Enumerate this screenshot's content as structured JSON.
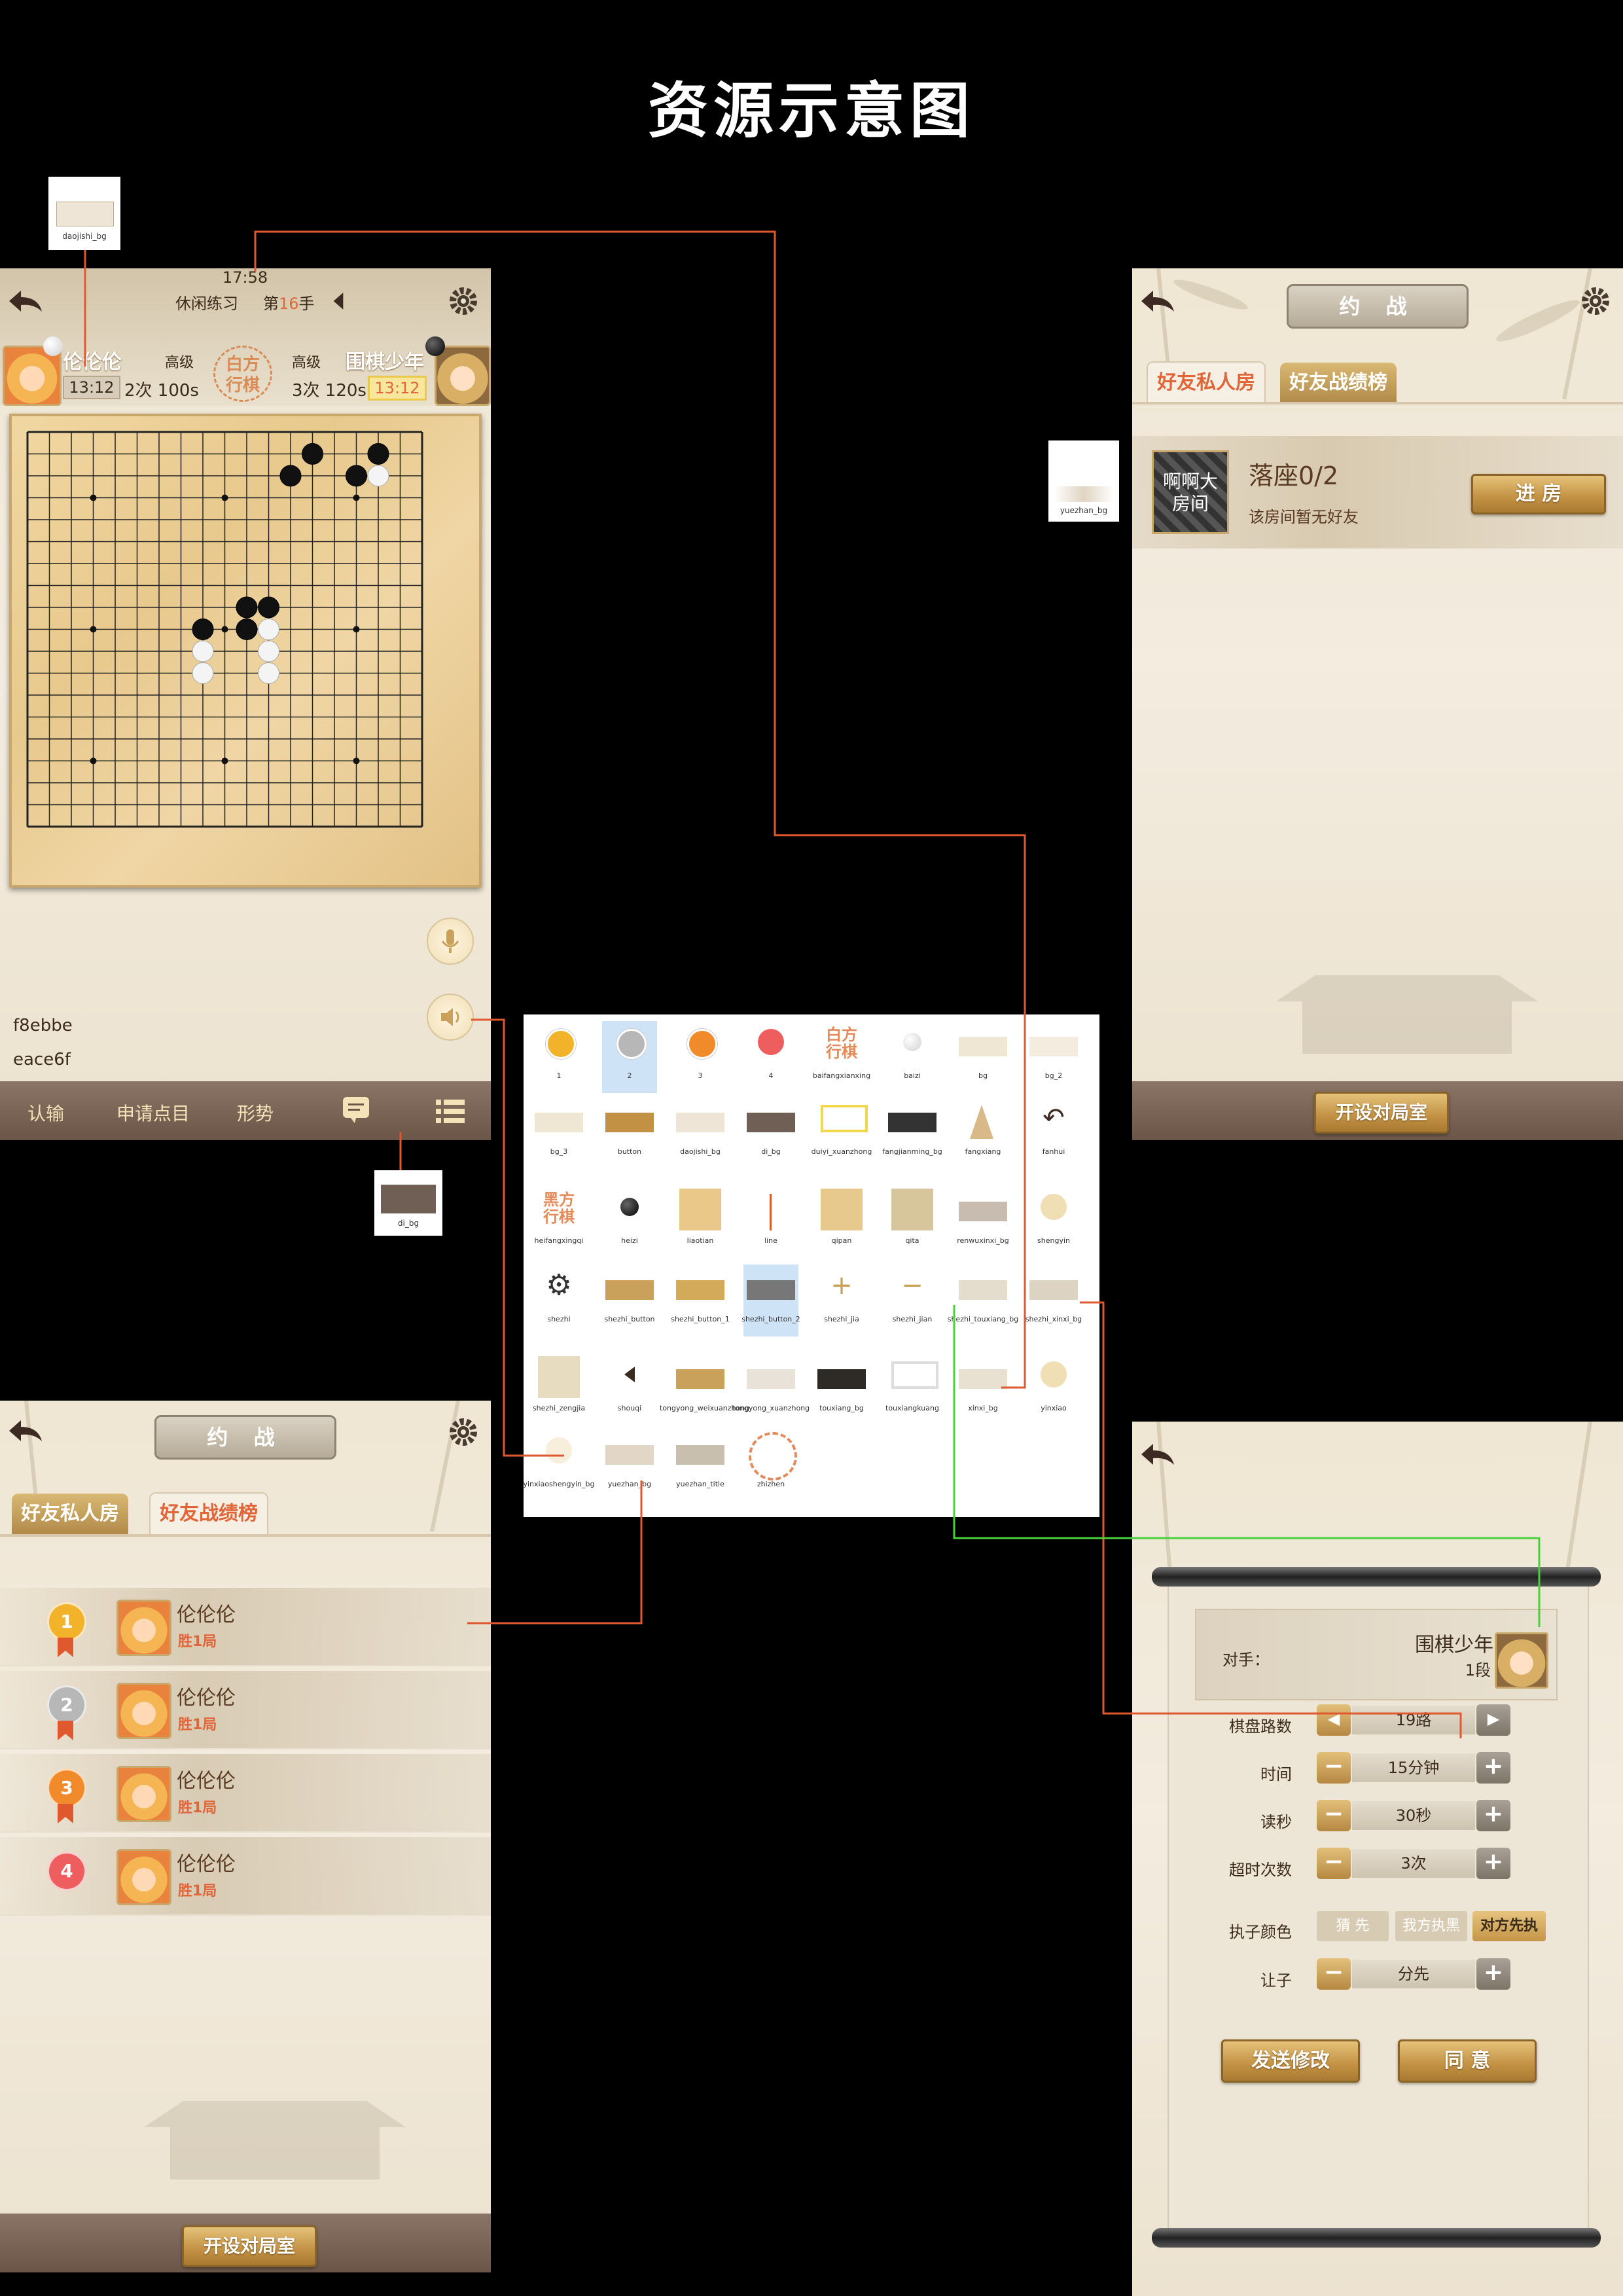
{
  "page_title": "资源示意图",
  "callouts": {
    "daojishi_bg": "daojishi_bg",
    "yuezhan_bg": "yuezhan_bg",
    "di_bg": "di_bg"
  },
  "game_screen": {
    "time": "17:58",
    "mode": "休闲练习",
    "move_prefix": "第",
    "move_num": "16",
    "move_suffix": "手",
    "player_left": {
      "name": "伦伦伦",
      "rank": "高级",
      "clock": "13:12",
      "counts": "2次 100s"
    },
    "player_right": {
      "name": "围棋少年",
      "rank": "高级",
      "clock": "13:12",
      "counts": "3次 120s"
    },
    "center_badge": "白方\n行棋",
    "color_note_1": "f8ebbe",
    "color_note_2": "eace6f",
    "bottom_buttons": [
      "认输",
      "申请点目",
      "形势"
    ]
  },
  "room_screen": {
    "title": "约 战",
    "tabs": [
      "好友私人房",
      "好友战绩榜"
    ],
    "room": {
      "name": "啊啊大\n房间",
      "seat": "落座0/2",
      "desc": "该房间暂无好友",
      "enter": "进 房"
    },
    "open_room": "开设对局室"
  },
  "rank_screen": {
    "title": "约 战",
    "tabs": [
      "好友私人房",
      "好友战绩榜"
    ],
    "entries": [
      {
        "rank": "1",
        "name": "伦伦伦",
        "result": "胜1局"
      },
      {
        "rank": "2",
        "name": "伦伦伦",
        "result": "胜1局"
      },
      {
        "rank": "3",
        "name": "伦伦伦",
        "result": "胜1局"
      },
      {
        "rank": "4",
        "name": "伦伦伦",
        "result": "胜1局"
      }
    ],
    "open_room": "开设对局室"
  },
  "settings_screen": {
    "opponent_label": "对手：",
    "opponent_name": "围棋少年",
    "opponent_rank": "1段",
    "rows": [
      {
        "label": "棋盘路数",
        "value": "19路"
      },
      {
        "label": "时间",
        "value": "15分钟"
      },
      {
        "label": "读秒",
        "value": "30秒"
      },
      {
        "label": "超时次数",
        "value": "3次"
      }
    ],
    "color_label": "执子颜色",
    "color_options": [
      "猜 先",
      "我方执黑",
      "对方先执"
    ],
    "handicap_label": "让子",
    "handicap_value": "分先",
    "send_btn": "发送修改",
    "agree_btn": "同 意"
  },
  "assets": [
    {
      "file": "1"
    },
    {
      "file": "2"
    },
    {
      "file": "3"
    },
    {
      "file": "4"
    },
    {
      "file": "baifangxianxing",
      "text": "白方\n行棋"
    },
    {
      "file": "baizi"
    },
    {
      "file": "bg"
    },
    {
      "file": "bg_2"
    },
    {
      "file": "bg_3"
    },
    {
      "file": "button"
    },
    {
      "file": "daojishi_bg"
    },
    {
      "file": "di_bg"
    },
    {
      "file": "duiyi_xuanzhong"
    },
    {
      "file": "fangjianming_bg"
    },
    {
      "file": "fangxiang"
    },
    {
      "file": "fanhui"
    },
    {
      "file": "heifangxingqi",
      "text": "黑方\n行棋"
    },
    {
      "file": "heizi"
    },
    {
      "file": "liaotian"
    },
    {
      "file": "line"
    },
    {
      "file": "qipan"
    },
    {
      "file": "qita"
    },
    {
      "file": "renwuxinxi_bg"
    },
    {
      "file": "shengyin"
    },
    {
      "file": "shezhi"
    },
    {
      "file": "shezhi_button"
    },
    {
      "file": "shezhi_button_1"
    },
    {
      "file": "shezhi_button_2"
    },
    {
      "file": "shezhi_jia"
    },
    {
      "file": "shezhi_jian"
    },
    {
      "file": "shezhi_touxiang_bg"
    },
    {
      "file": "shezhi_xinxi_bg"
    },
    {
      "file": "shezhi_zengjia"
    },
    {
      "file": "shouqi"
    },
    {
      "file": "tongyong_weixuanzhong"
    },
    {
      "file": "tongyong_xuanzhong"
    },
    {
      "file": "touxiang_bg"
    },
    {
      "file": "touxiangkuang"
    },
    {
      "file": "xinxi_bg"
    },
    {
      "file": "yinxiao"
    },
    {
      "file": "yinxiaoshengyin_bg"
    },
    {
      "file": "yuezhan_bg"
    },
    {
      "file": "yuezhan_title"
    },
    {
      "file": "zhizhen"
    }
  ]
}
